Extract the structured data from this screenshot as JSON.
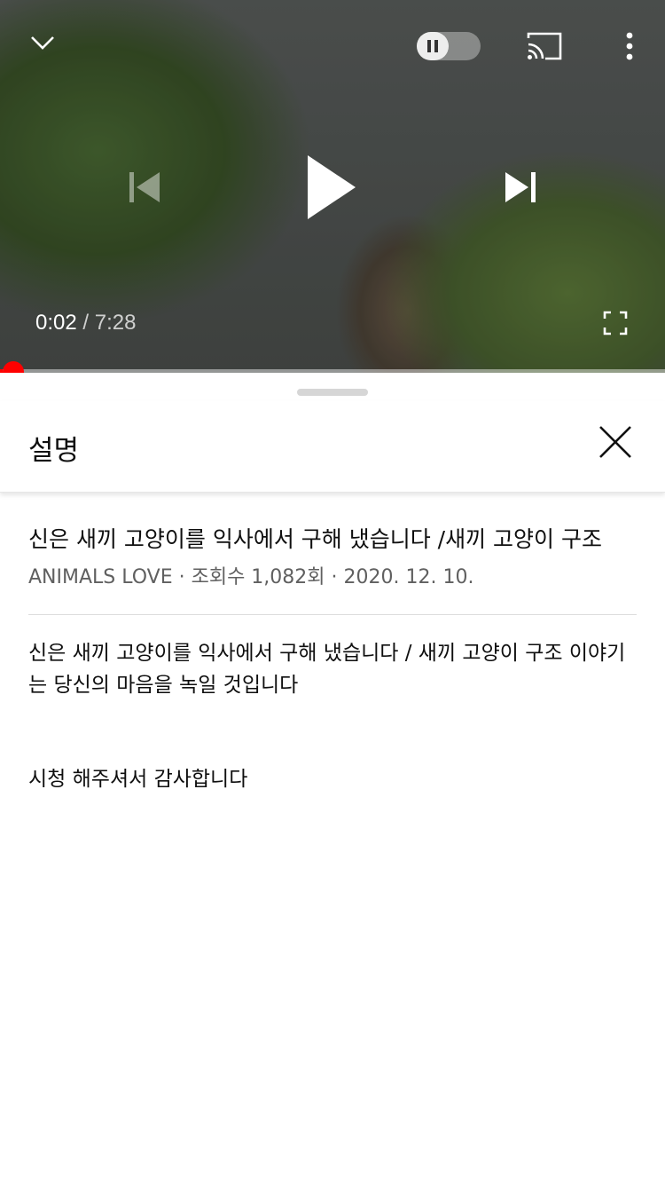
{
  "player": {
    "current_time": "0:02",
    "duration": "/ 7:28",
    "progress": 0.0045,
    "colors": {
      "accent": "#ff0000"
    },
    "icons": {
      "minimize": "chevron-down-icon",
      "autoplay": "pause-icon",
      "cast": "cast-icon",
      "more": "more-vertical-icon",
      "previous": "skip-previous-icon",
      "play": "play-icon",
      "next": "skip-next-icon",
      "fullscreen": "fullscreen-icon"
    }
  },
  "description_panel": {
    "title": "설명",
    "close_icon": "close-icon",
    "video_title": "신은 새끼 고양이를 익사에서 구해 냈습니다 /새끼 고양이 구조",
    "channel": "ANIMALS LOVE",
    "views": "조회수 1,082회",
    "date": "2020. 12. 10.",
    "separator": "·",
    "description": "신은 새끼 고양이를 익사에서 구해 냈습니다 / 새끼 고양이 구조 이야기는 당신의 마음을 녹일 것입니다",
    "thanks": "시청 해주셔서 감사합니다"
  }
}
